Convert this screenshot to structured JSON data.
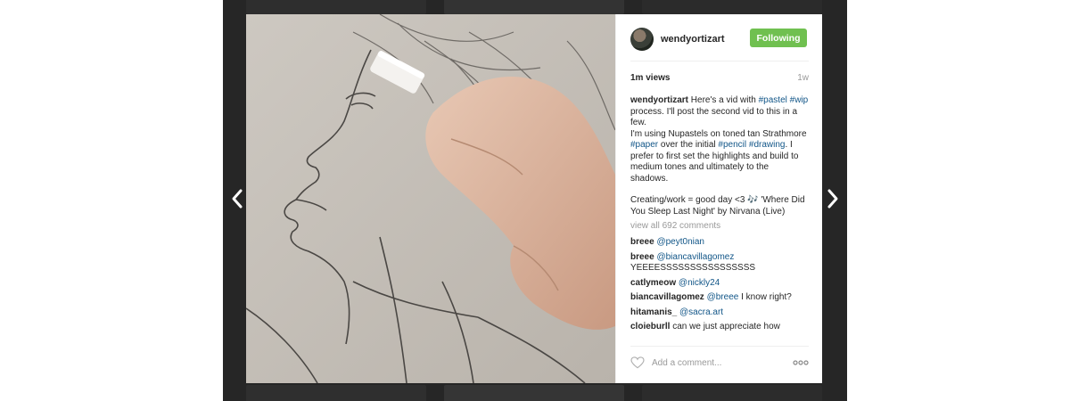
{
  "post": {
    "username": "wendyortizart",
    "follow_label": "Following",
    "views": "1m views",
    "age": "1w"
  },
  "caption": {
    "author": "wendyortizart",
    "p1_text1": " Here's a vid with ",
    "tag_pastel": "#pastel",
    "tag_wip": "#wip",
    "p1_text2": " process. I'll post the second vid to this in a few.",
    "p2_text1": "I'm using Nupastels on toned tan Strathmore ",
    "tag_paper": "#paper",
    "p2_text2": " over the initial ",
    "tag_pencil": "#pencil",
    "tag_drawing": "#drawing",
    "p2_text3": ". I prefer to first set the highlights and build to medium tones and ultimately to the shadows.",
    "p3_text": "Creating/work = good day <3 🎶 'Where Did You Sleep Last Night' by Nirvana (Live)"
  },
  "view_all": "view all 692 comments",
  "comments": [
    {
      "user": "breee",
      "mention": "@peyt0nian",
      "text": ""
    },
    {
      "user": "breee",
      "mention": "@biancavillagomez",
      "text": " YEEEESSSSSSSSSSSSSSSS"
    },
    {
      "user": "catlymeow",
      "mention": "@nickly24",
      "text": ""
    },
    {
      "user": "biancavillagomez",
      "mention": "@breee",
      "text": " I know right?"
    },
    {
      "user": "hitamanis_",
      "mention": "@sacra.art",
      "text": ""
    },
    {
      "user": "cloieburll",
      "mention": "",
      "text": " can we just appreciate how"
    }
  ],
  "add_comment_placeholder": "Add a comment...",
  "icons": {
    "prev": "chevron-left-icon",
    "next": "chevron-right-icon",
    "like": "heart-icon",
    "more": "more-options-icon"
  },
  "colors": {
    "follow_bg": "#70c050",
    "link": "#125688",
    "overlay": "#262626"
  }
}
